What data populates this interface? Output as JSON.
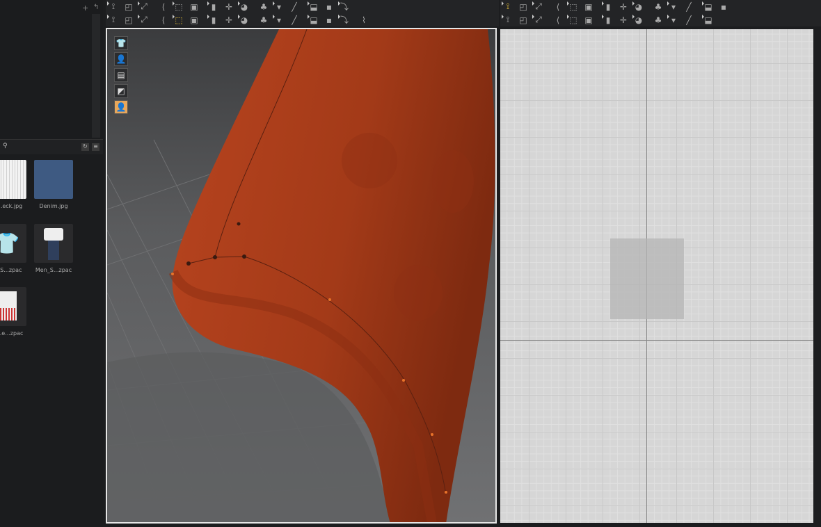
{
  "library": {
    "search_icon": "search-icon",
    "items": [
      {
        "name": "...eck.jpg",
        "kind": "texture-check"
      },
      {
        "name": "Denim.jpg",
        "kind": "texture-denim"
      },
      {
        "name": "..._S...zpac",
        "kind": "garment-shorts"
      },
      {
        "name": "Men_S...zpac",
        "kind": "garment-men"
      },
      {
        "name": "...e...zpac",
        "kind": "garment-dress"
      }
    ]
  },
  "toolbar3d_row1": [
    "arrow-down",
    "move",
    "box-select",
    "transform",
    "fold",
    "edit-pin",
    "brush",
    "fit",
    "segment",
    "tuck",
    "drape",
    "avatar-arrange",
    "zipper",
    "layer",
    "measure"
  ],
  "toolbar3d_row2": [
    "simulate",
    "select-mesh",
    "edit-mesh",
    "select-curve",
    "fold-tool",
    "tack",
    "pin",
    "sew-stitch",
    "fuse",
    "button",
    "button-hole",
    "topstitch",
    "lock",
    "zip",
    "puckering",
    "flatten"
  ],
  "toolbar2d_row1": [
    "edit-pattern",
    "edit-point",
    "curve-point",
    "add-point",
    "circle-point",
    "seam-points",
    "internal",
    "rectangle",
    "polygon",
    "circle",
    "shape",
    "box",
    "ring",
    "dart"
  ],
  "toolbar2d_row2": [
    "segment-sew",
    "free-sew",
    "multi-sew",
    "check-sew",
    "edit-sewing",
    "steam",
    "garment-tool",
    "pin-tool",
    "select-mesh",
    "mesh-all",
    "fabric-show",
    "line",
    "tape"
  ],
  "viewport3d_tools": [
    "show-garment",
    "show-avatar",
    "show-fabric",
    "texture",
    "avatar-skin"
  ],
  "colors": {
    "garment": "#a8391a",
    "accent": "#e8c23a"
  }
}
